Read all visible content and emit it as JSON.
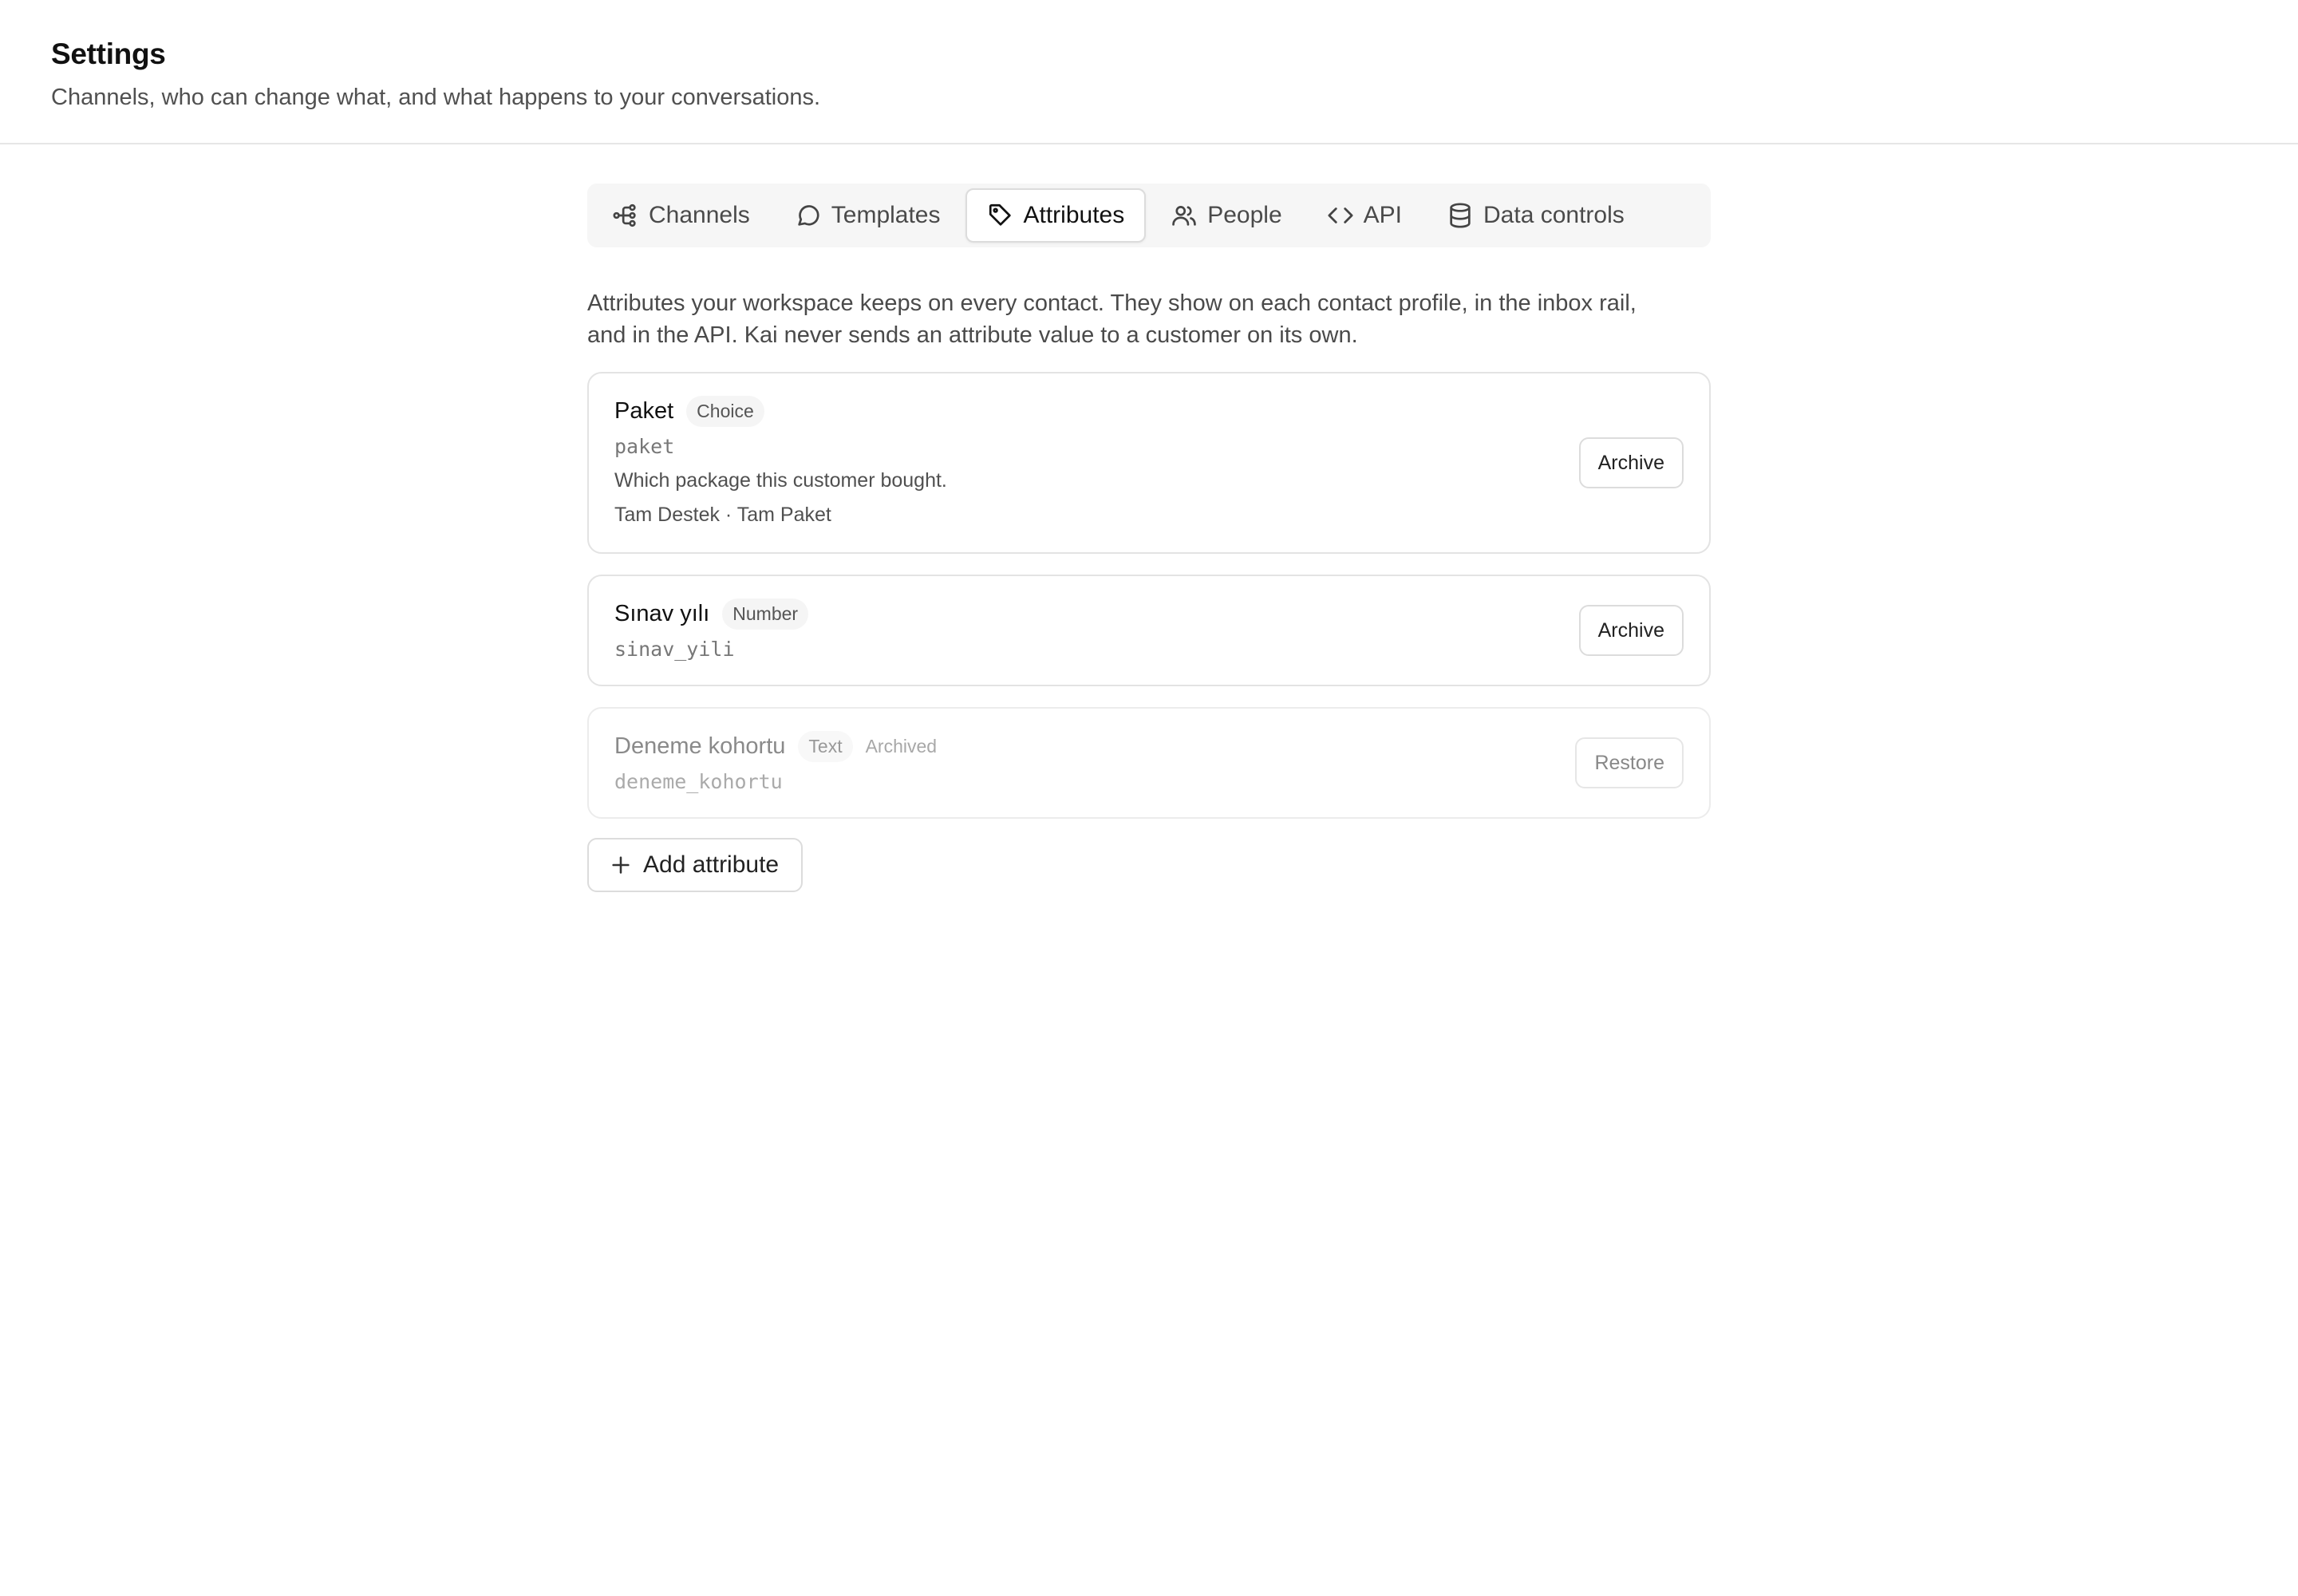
{
  "header": {
    "title": "Settings",
    "subtitle": "Channels, who can change what, and what happens to your conversations."
  },
  "tabs": [
    {
      "label": "Channels",
      "icon": "channels-icon",
      "active": false
    },
    {
      "label": "Templates",
      "icon": "chat-bubble-icon",
      "active": false
    },
    {
      "label": "Attributes",
      "icon": "tag-icon",
      "active": true
    },
    {
      "label": "People",
      "icon": "people-icon",
      "active": false
    },
    {
      "label": "API",
      "icon": "code-icon",
      "active": false
    },
    {
      "label": "Data controls",
      "icon": "database-icon",
      "active": false
    }
  ],
  "intro": "Attributes your workspace keeps on every contact. They show on each contact profile, in the inbox rail, and in the API. Kai never sends an attribute value to a customer on its own.",
  "attributes": [
    {
      "name": "Paket",
      "type": "Choice",
      "key": "paket",
      "description": "Which package this customer bought.",
      "options": "Tam Destek · Tam Paket",
      "action": "Archive"
    },
    {
      "name": "Sınav yılı",
      "type": "Number",
      "key": "sinav_yili",
      "action": "Archive"
    },
    {
      "name": "Deneme kohortu",
      "type": "Text",
      "status": "Archived",
      "key": "deneme_kohortu",
      "action": "Restore"
    }
  ],
  "add_button": "Add attribute"
}
